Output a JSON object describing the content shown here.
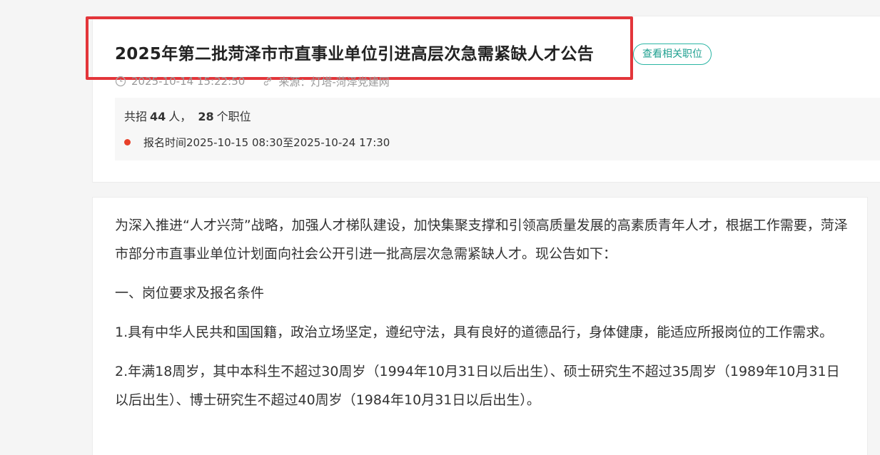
{
  "article": {
    "title": "2025年第二批菏泽市市直事业单位引进高层次急需紧缺人才公告",
    "related_jobs_label": "查看相关职位",
    "datetime": "2025-10-14 15:22:50",
    "source": "来源：灯塔-菏泽党建网"
  },
  "summary": {
    "prefix": "共招",
    "people_count": "44",
    "people_unit": "人，",
    "position_count": "28",
    "position_unit": "个职位",
    "registration": "报名时间2025-10-15 08:30至2025-10-24 17:30"
  },
  "content": {
    "paragraphs": [
      "为深入推进“人才兴菏”战略，加强人才梯队建设，加快集聚支撑和引领高质量发展的高素质青年人才，根据工作需要，菏泽市部分市直事业单位计划面向社会公开引进一批高层次急需紧缺人才。现公告如下：",
      "一、岗位要求及报名条件",
      "1.具有中华人民共和国国籍，政治立场坚定，遵纪守法，具有良好的道德品行，身体健康，能适应所报岗位的工作需求。",
      "2.年满18周岁，其中本科生不超过30周岁（1994年10月31日以后出生）、硕士研究生不超过35周岁（1989年10月31日以后出生）、博士研究生不超过40周岁（1984年10月31日以后出生）。"
    ]
  },
  "colors": {
    "highlight": "#e3353a",
    "accent": "#2bb5a4",
    "dot": "#e8402a"
  },
  "icons": [
    "clock-icon",
    "link-icon"
  ]
}
